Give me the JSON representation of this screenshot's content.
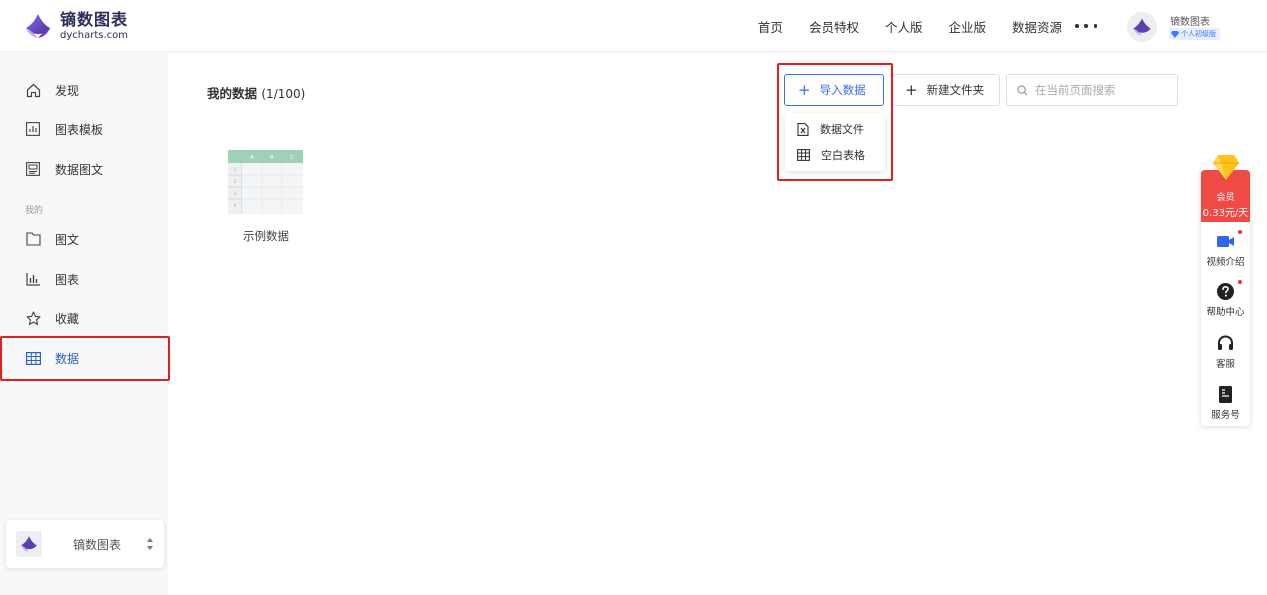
{
  "brand": {
    "name": "镝数图表",
    "domain": "dycharts.com"
  },
  "top_nav": {
    "items": [
      {
        "label": "首页"
      },
      {
        "label": "会员特权"
      },
      {
        "label": "个人版"
      },
      {
        "label": "企业版"
      },
      {
        "label": "数据资源"
      }
    ],
    "more_icon": "more-icon"
  },
  "user": {
    "name": "镝数图表",
    "badge": "个人初级版"
  },
  "sidebar": {
    "items": [
      {
        "label": "发现",
        "icon": "home-icon"
      },
      {
        "label": "图表模板",
        "icon": "chart-template-icon"
      },
      {
        "label": "数据图文",
        "icon": "data-article-icon"
      }
    ],
    "section_label": "我的",
    "my_items": [
      {
        "label": "图文",
        "icon": "article-icon"
      },
      {
        "label": "图表",
        "icon": "chart-icon"
      },
      {
        "label": "收藏",
        "icon": "star-icon"
      },
      {
        "label": "数据",
        "icon": "table-icon",
        "active": true
      }
    ],
    "workspace": {
      "name": "镝数图表"
    }
  },
  "main": {
    "title": "我的数据",
    "count": "(1/100)",
    "import_button": "导入数据",
    "new_folder_button": "新建文件夹",
    "search_placeholder": "在当前页面搜索",
    "import_menu": [
      {
        "label": "数据文件",
        "icon": "excel-file-icon"
      },
      {
        "label": "空白表格",
        "icon": "blank-table-icon"
      }
    ],
    "files": [
      {
        "name": "示例数据",
        "thumb_columns": [
          "A",
          "B",
          "C"
        ],
        "thumb_rows": [
          "1",
          "2",
          "3",
          "4"
        ]
      }
    ]
  },
  "float_bar": {
    "vip_label": "会员",
    "vip_price": "0.33元/天",
    "items": [
      {
        "label": "视频介绍",
        "icon": "video-icon",
        "dot": true
      },
      {
        "label": "帮助中心",
        "icon": "help-icon",
        "dot": true
      },
      {
        "label": "客服",
        "icon": "headset-icon",
        "dot": false
      },
      {
        "label": "服务号",
        "icon": "service-account-icon",
        "dot": false
      }
    ]
  },
  "colors": {
    "accent": "#3a6ef6",
    "highlight_frame": "#e02020",
    "vip": "#f04a45"
  }
}
